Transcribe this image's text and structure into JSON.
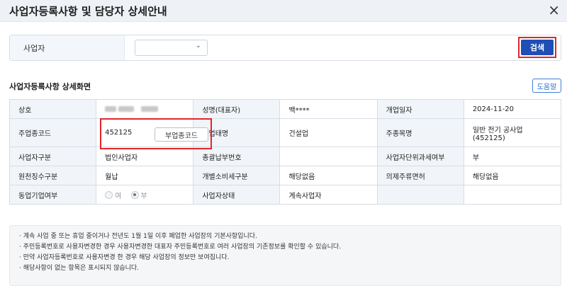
{
  "header": {
    "title": "사업자등록사항 및 담당자 상세안내",
    "close_icon": "×"
  },
  "search": {
    "label": "사업자",
    "select_value": "",
    "chevron_icon": "⌄",
    "button_label": "검색"
  },
  "section": {
    "title": "사업자등록사항 상세화면",
    "help_label": "도움말"
  },
  "table": {
    "rows": [
      [
        {
          "label": "상호",
          "value": ""
        },
        {
          "label": "성명(대표자)",
          "value": "백****"
        },
        {
          "label": "개업일자",
          "value": "2024-11-20"
        }
      ],
      [
        {
          "label": "주업종코드",
          "value": "452125"
        },
        {
          "label": "주업태명",
          "value": "건설업"
        },
        {
          "label": "주종목명",
          "value": "일반 전기 공사업(452125)"
        }
      ],
      [
        {
          "label": "사업자구분",
          "value": "법인사업자"
        },
        {
          "label": "총괄납부번호",
          "value": ""
        },
        {
          "label": "사업자단위과세여부",
          "value": "부"
        }
      ],
      [
        {
          "label": "원천징수구분",
          "value": "월납"
        },
        {
          "label": "개별소비세구분",
          "value": "해당없음"
        },
        {
          "label": "의제주류면허",
          "value": "해당없음"
        }
      ],
      [
        {
          "label": "동업기업여부",
          "value": ""
        },
        {
          "label": "사업자상태",
          "value": "계속사업자"
        },
        {
          "label": "",
          "value": ""
        }
      ]
    ],
    "sub_industry_button": "부업종코드",
    "radio_yes": "여",
    "radio_no": "부"
  },
  "notes": [
    "· 계속 사업 중 또는 휴업 중이거나 전년도 1월 1일 이후 폐업한 사업장의 기본사항입니다.",
    "· 주민등록번호로 사용자변경한 경우 사용자변경한 대표자 주민등록번호로 여러 사업장의 기존정보를 확인할 수 있습니다.",
    "· 만약 사업자등록번호로 사용자변경 한 경우 해당 사업장의 정보만 보여집니다.",
    "· 해당사항이 없는 항목은 표시되지 않습니다."
  ]
}
